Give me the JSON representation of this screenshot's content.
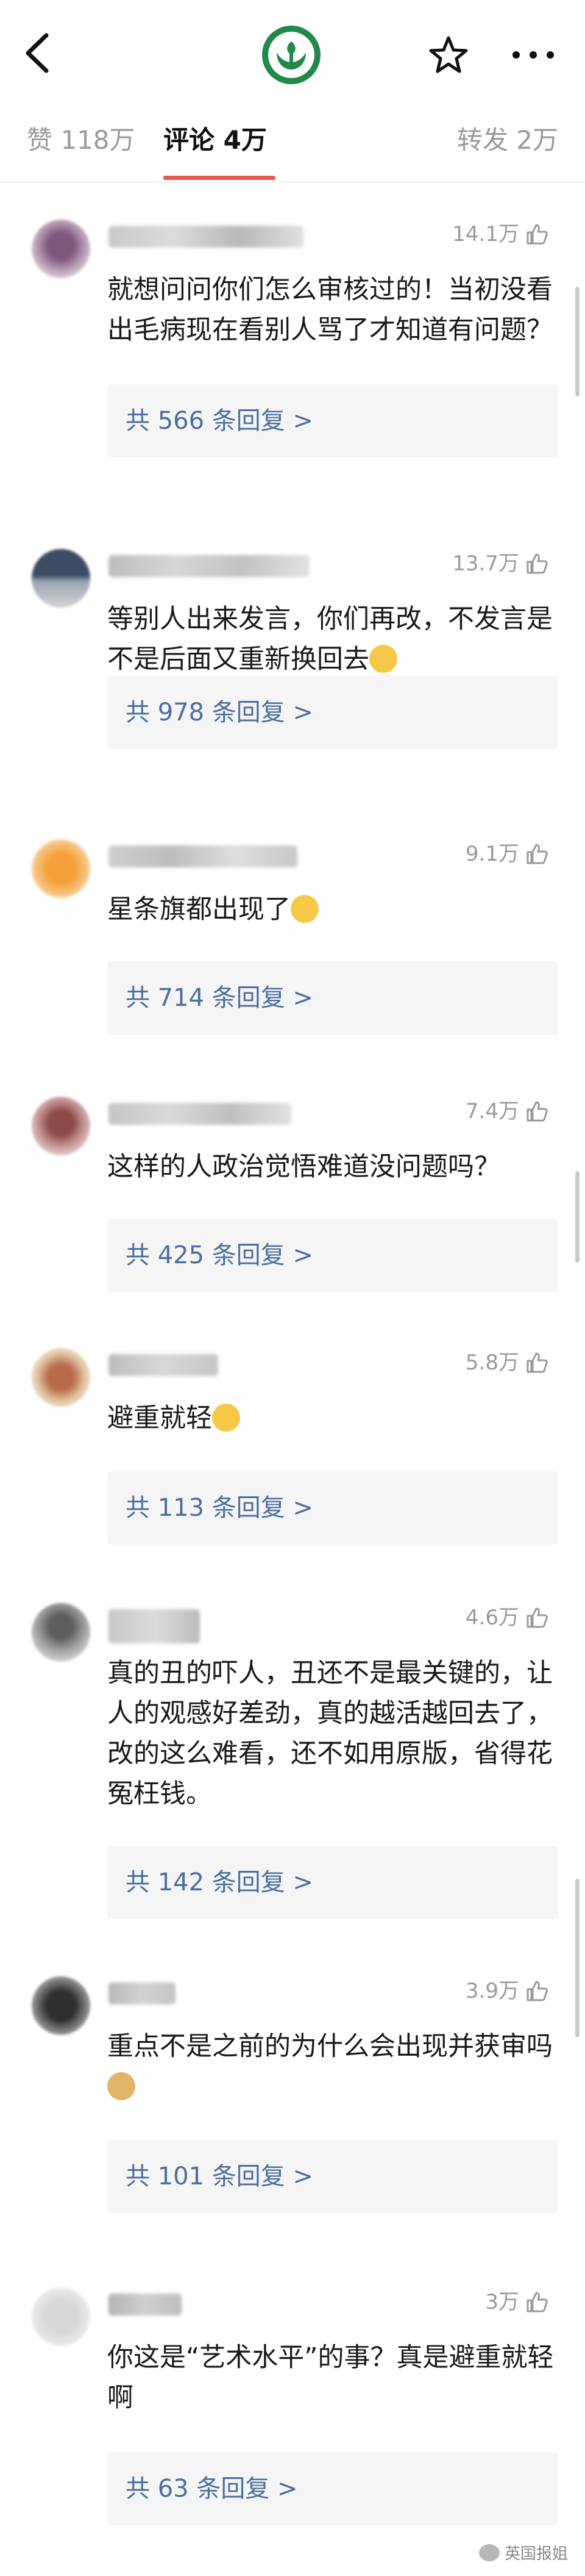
{
  "header": {
    "back_icon": "chevron-left-icon",
    "logo_icon": "green-leaf-hands-logo",
    "star_icon": "star-outline-icon",
    "more_icon": "more-dots-icon"
  },
  "tabs": {
    "like": "赞 118万",
    "comment": "评论 4万",
    "repost": "转发 2万"
  },
  "comments": [
    {
      "likes": "14.1万",
      "text": "就想问问你们怎么审核过的！当初没看出毛病现在看别人骂了才知道有问题？",
      "replies": "共 566 条回复 >"
    },
    {
      "likes": "13.7万",
      "text": "等别人出来发言，你们再改，不发言是不是后面又重新换回去",
      "emoji": "smirk-emoji",
      "replies": "共 978 条回复 >"
    },
    {
      "likes": "9.1万",
      "text": "星条旗都出现了",
      "emoji": "crying-emoji",
      "replies": "共 714 条回复 >"
    },
    {
      "likes": "7.4万",
      "text": "这样的人政治觉悟难道没问题吗？",
      "replies": "共 425 条回复 >"
    },
    {
      "likes": "5.8万",
      "text": "避重就轻",
      "emoji": "shrug-emoji",
      "replies": "共 113 条回复 >"
    },
    {
      "likes": "4.6万",
      "text": "真的丑的吓人，丑还不是最关键的，让人的观感好差劲，真的越活越回去了，改的这么难看，还不如用原版，省得花冤枉钱。",
      "replies": "共 142 条回复 >"
    },
    {
      "likes": "3.9万",
      "text": "重点不是之前的为什么会出现并获审吗",
      "emoji": "doge-emoji",
      "replies": "共 101 条回复 >"
    },
    {
      "likes": "3万",
      "text": "你这是“艺术水平”的事？真是避重就轻啊",
      "replies": "共 63 条回复 >"
    }
  ],
  "watermark": "英国报姐",
  "colors": {
    "accent": "#e85a4f",
    "reply_link": "#4a6fa0",
    "logo_green": "#1f8a4a"
  }
}
